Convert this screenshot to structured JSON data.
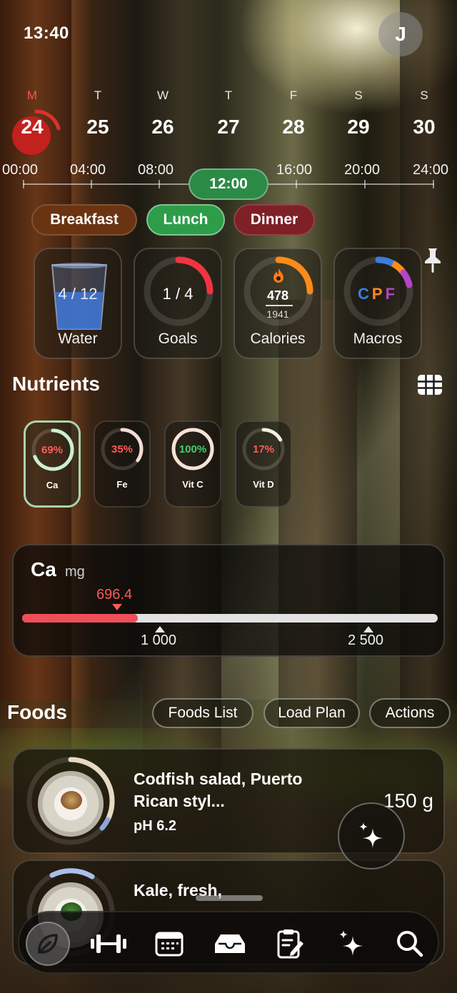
{
  "status": {
    "time": "13:40"
  },
  "profile": {
    "initial": "J"
  },
  "week": [
    {
      "letter": "M",
      "num": "24",
      "today": true
    },
    {
      "letter": "T",
      "num": "25"
    },
    {
      "letter": "W",
      "num": "26"
    },
    {
      "letter": "T",
      "num": "27"
    },
    {
      "letter": "F",
      "num": "28"
    },
    {
      "letter": "S",
      "num": "29"
    },
    {
      "letter": "S",
      "num": "30"
    }
  ],
  "timeline": {
    "labels": [
      "00:00",
      "04:00",
      "08:00",
      "16:00",
      "20:00",
      "24:00"
    ],
    "current": "12:00"
  },
  "meals": {
    "breakfast": "Breakfast",
    "lunch": "Lunch",
    "dinner": "Dinner",
    "selected": "Lunch"
  },
  "widgets": {
    "water": {
      "label": "Water",
      "value": "4 / 12",
      "progress": 0.333
    },
    "goals": {
      "label": "Goals",
      "value": "1 / 4",
      "progress": 0.25
    },
    "calories": {
      "label": "Calories",
      "value": "478",
      "target": "1941",
      "progress": 0.246
    },
    "macros": {
      "label": "Macros",
      "c": "C",
      "p": "P",
      "f": "F"
    }
  },
  "nutrients": {
    "title": "Nutrients",
    "items": [
      {
        "name": "Ca",
        "pct": "69%",
        "progress": 0.69,
        "color": "#ff5a5a",
        "selected": true
      },
      {
        "name": "Fe",
        "pct": "35%",
        "progress": 0.35,
        "color": "#ff5a5a"
      },
      {
        "name": "Vit C",
        "pct": "100%",
        "progress": 1.0,
        "color": "#3ed16a"
      },
      {
        "name": "Vit D",
        "pct": "17%",
        "progress": 0.17,
        "color": "#ff5a5a"
      }
    ]
  },
  "detail": {
    "nutrient": "Ca",
    "unit": "mg",
    "value": "696.4",
    "progress": 0.2786,
    "marker1": "1 000",
    "marker2": "2 500"
  },
  "foods": {
    "title": "Foods",
    "buttons": {
      "list": "Foods List",
      "load": "Load Plan",
      "actions": "Actions"
    },
    "items": [
      {
        "name": "Codfish salad, Puerto Rican styl...",
        "ph": "pH 6.2",
        "qty": "150 g"
      },
      {
        "name": "Kale, fresh,",
        "ph": "",
        "qty": ""
      }
    ]
  },
  "tabbar": {
    "items": [
      "leaf-icon",
      "dumbbell-icon",
      "calendar-icon",
      "inbox-icon",
      "clipboard-edit-icon",
      "sparkles-icon",
      "search-icon"
    ]
  },
  "colors": {
    "today": "#c2211e",
    "lunch": "#2e9d4a",
    "breakfast": "#6a3412",
    "dinner": "#7d2126",
    "accent_red": "#f04f5a",
    "calorie_orange": "#ff8a1a"
  }
}
